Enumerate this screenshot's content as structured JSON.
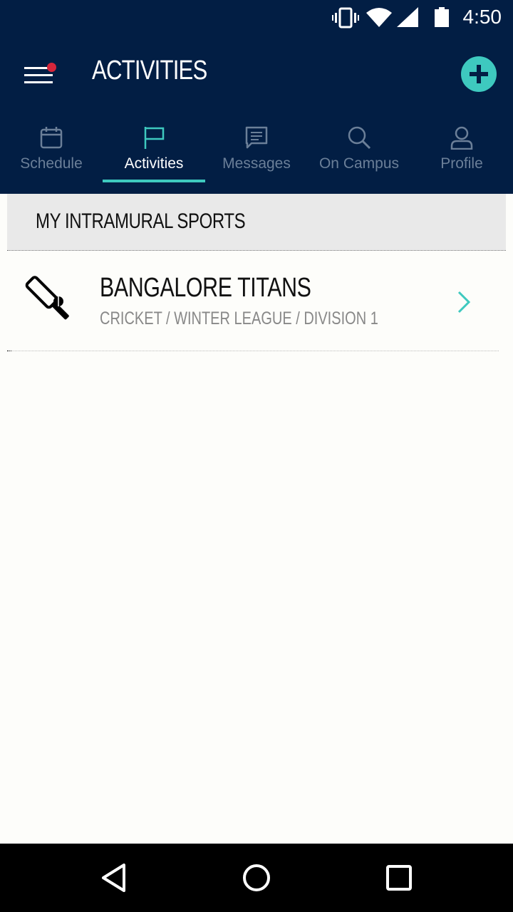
{
  "status_bar": {
    "time": "4:50",
    "icons": [
      "vibrate-icon",
      "wifi-icon",
      "signal-icon",
      "battery-icon"
    ]
  },
  "app_bar": {
    "title": "ACTIVITIES",
    "has_notification": true,
    "menu_icon": "hamburger-menu-icon",
    "add_icon": "plus-icon"
  },
  "tabs": [
    {
      "label": "Schedule",
      "icon": "calendar-icon",
      "active": false
    },
    {
      "label": "Activities",
      "icon": "flag-icon",
      "active": true
    },
    {
      "label": "Messages",
      "icon": "message-icon",
      "active": false
    },
    {
      "label": "On Campus",
      "icon": "search-icon",
      "active": false
    },
    {
      "label": "Profile",
      "icon": "person-icon",
      "active": false
    }
  ],
  "section": {
    "title": "MY INTRAMURAL SPORTS"
  },
  "teams": [
    {
      "name": "BANGALORE TITANS",
      "subtitle": "CRICKET / WINTER LEAGUE / DIVISION 1",
      "icon": "cricket-bat-icon"
    }
  ],
  "colors": {
    "navy": "#021e44",
    "accent": "#3ec9bf",
    "notification": "#d6263b",
    "inactive_tab": "#6b7f98"
  },
  "nav_bar": {
    "icons": [
      "back-icon",
      "home-icon",
      "recents-icon"
    ]
  }
}
